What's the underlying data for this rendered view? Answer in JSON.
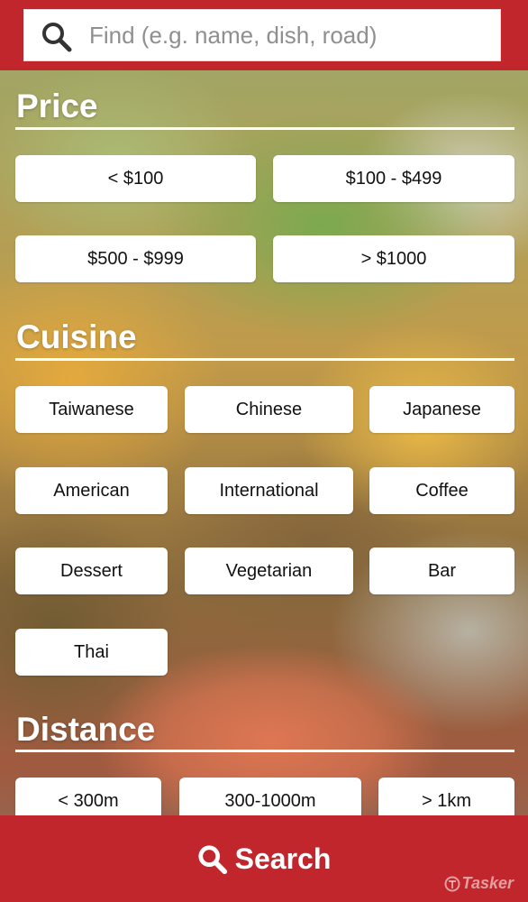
{
  "search": {
    "placeholder": "Find (e.g. name, dish, road)",
    "value": ""
  },
  "price": {
    "title": "Price",
    "options": [
      "< $100",
      "$100 - $499",
      "$500 - $999",
      "> $1000"
    ]
  },
  "cuisine": {
    "title": "Cuisine",
    "options": [
      "Taiwanese",
      "Chinese",
      "Japanese",
      "American",
      "International",
      "Coffee",
      "Dessert",
      "Vegetarian",
      "Bar",
      "Thai"
    ]
  },
  "distance": {
    "title": "Distance",
    "options": [
      "< 300m",
      "300-1000m",
      "> 1km"
    ]
  },
  "bottom": {
    "search_label": "Search"
  },
  "watermark": {
    "label": "Tasker"
  },
  "colors": {
    "brand_red": "#c0262c",
    "chip_bg": "#ffffff"
  }
}
